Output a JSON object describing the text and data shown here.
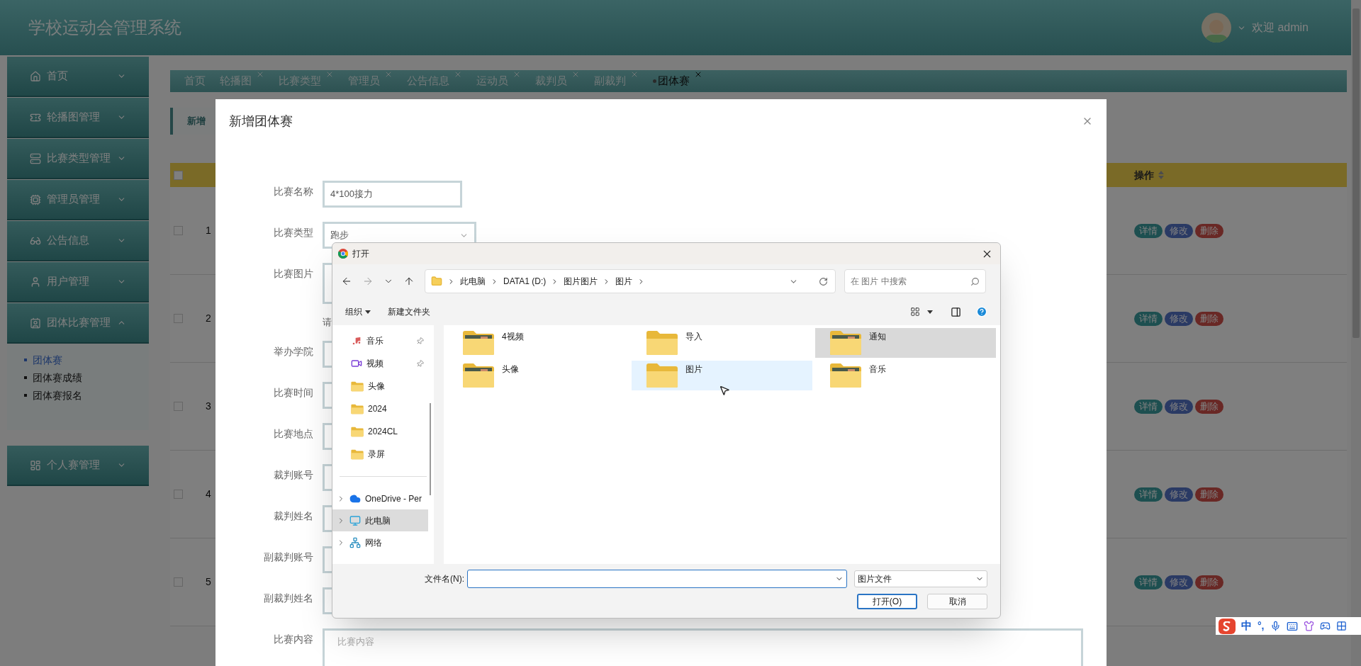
{
  "header": {
    "title": "学校运动会管理系统",
    "welcome": "欢迎 admin"
  },
  "sidebar": [
    {
      "label": "首页",
      "expanded": false
    },
    {
      "label": "轮播图管理",
      "expanded": false
    },
    {
      "label": "比赛类型管理",
      "expanded": false
    },
    {
      "label": "管理员管理",
      "expanded": false
    },
    {
      "label": "公告信息",
      "expanded": false
    },
    {
      "label": "用户管理",
      "expanded": false
    },
    {
      "label": "团体比赛管理",
      "expanded": true,
      "children": [
        {
          "label": "团体赛",
          "selected": true
        },
        {
          "label": "团体赛成绩",
          "selected": false
        },
        {
          "label": "团体赛报名",
          "selected": false
        }
      ]
    },
    {
      "label": "个人赛管理",
      "expanded": false
    }
  ],
  "tabs": [
    {
      "label": "首页",
      "closable": false,
      "selected": false
    },
    {
      "label": "轮播图",
      "closable": true,
      "selected": false
    },
    {
      "label": "比赛类型",
      "closable": true,
      "selected": false
    },
    {
      "label": "管理员",
      "closable": true,
      "selected": false
    },
    {
      "label": "公告信息",
      "closable": true,
      "selected": false
    },
    {
      "label": "运动员",
      "closable": true,
      "selected": false
    },
    {
      "label": "裁判员",
      "closable": true,
      "selected": false
    },
    {
      "label": "副裁判",
      "closable": true,
      "selected": false
    },
    {
      "label": "团体赛",
      "closable": true,
      "selected": true
    }
  ],
  "add_button": "新增",
  "table": {
    "select_all_checked": false,
    "action_header": "操作",
    "rows": [
      {
        "checked": false,
        "number": "1",
        "actions": [
          {
            "kind": "detail",
            "label": "详情"
          },
          {
            "kind": "edit",
            "label": "修改"
          },
          {
            "kind": "delete",
            "label": "删除"
          }
        ]
      },
      {
        "checked": false,
        "number": "2",
        "actions": [
          {
            "kind": "detail",
            "label": "详情"
          },
          {
            "kind": "edit",
            "label": "修改"
          },
          {
            "kind": "delete",
            "label": "删除"
          }
        ]
      },
      {
        "checked": false,
        "number": "3",
        "actions": [
          {
            "kind": "detail",
            "label": "详情"
          },
          {
            "kind": "edit",
            "label": "修改"
          },
          {
            "kind": "delete",
            "label": "删除"
          }
        ]
      },
      {
        "checked": false,
        "number": "4",
        "actions": [
          {
            "kind": "detail",
            "label": "详情"
          },
          {
            "kind": "edit",
            "label": "修改"
          },
          {
            "kind": "delete",
            "label": "删除"
          }
        ]
      },
      {
        "checked": false,
        "number": "5",
        "actions": [
          {
            "kind": "detail",
            "label": "详情"
          },
          {
            "kind": "edit",
            "label": "修改"
          },
          {
            "kind": "delete",
            "label": "删除"
          }
        ]
      }
    ]
  },
  "modal": {
    "title": "新增团体赛",
    "fields": [
      {
        "kind": "text",
        "label": "比赛名称",
        "value": "4*100接力"
      },
      {
        "kind": "select",
        "label": "比赛类型",
        "value": "跑步"
      },
      {
        "kind": "upload",
        "label": "比赛图片"
      },
      {
        "kind": "hint",
        "text": "请"
      },
      {
        "kind": "text",
        "label": "举办学院"
      },
      {
        "kind": "text",
        "label": "比赛时间"
      },
      {
        "kind": "text",
        "label": "比赛地点"
      },
      {
        "kind": "text",
        "label": "裁判账号"
      },
      {
        "kind": "text",
        "label": "裁判姓名"
      },
      {
        "kind": "text",
        "label": "副裁判账号"
      },
      {
        "kind": "text",
        "label": "副裁判姓名"
      },
      {
        "kind": "textarea",
        "label": "比赛内容",
        "placeholder": "比赛内容"
      }
    ]
  },
  "file_dialog": {
    "title": "打开",
    "breadcrumbs": [
      "此电脑",
      "DATA1 (D:)",
      "图片图片",
      "图片"
    ],
    "search_placeholder": "在 图片 中搜索",
    "organize": "组织",
    "new_folder": "新建文件夹",
    "quick_access": [
      {
        "label": "音乐",
        "pinned": true
      },
      {
        "label": "视频",
        "pinned": true
      },
      {
        "label": "头像",
        "pinned": false
      },
      {
        "label": "2024",
        "pinned": false
      },
      {
        "label": "2024CL",
        "pinned": false
      },
      {
        "label": "录屏",
        "pinned": false
      }
    ],
    "locations": [
      {
        "label": "OneDrive - Per",
        "selected": false
      },
      {
        "label": "此电脑",
        "selected": true
      },
      {
        "label": "网络",
        "selected": false
      }
    ],
    "folders": [
      {
        "label": "4视频",
        "preview": true,
        "selected": false,
        "hovered": false
      },
      {
        "label": "导入",
        "preview": false,
        "selected": false,
        "hovered": false
      },
      {
        "label": "通知",
        "preview": true,
        "selected": true,
        "hovered": false
      },
      {
        "label": "头像",
        "preview": true,
        "selected": false,
        "hovered": false
      },
      {
        "label": "图片",
        "preview": false,
        "selected": false,
        "hovered": true
      },
      {
        "label": "音乐",
        "preview": true,
        "selected": false,
        "hovered": false
      }
    ],
    "filename_label": "文件名(N):",
    "file_type": "图片文件",
    "open_button": "打开(O)",
    "cancel_button": "取消"
  },
  "ime_bar": {
    "mode": "中",
    "punctuation": "°,"
  }
}
